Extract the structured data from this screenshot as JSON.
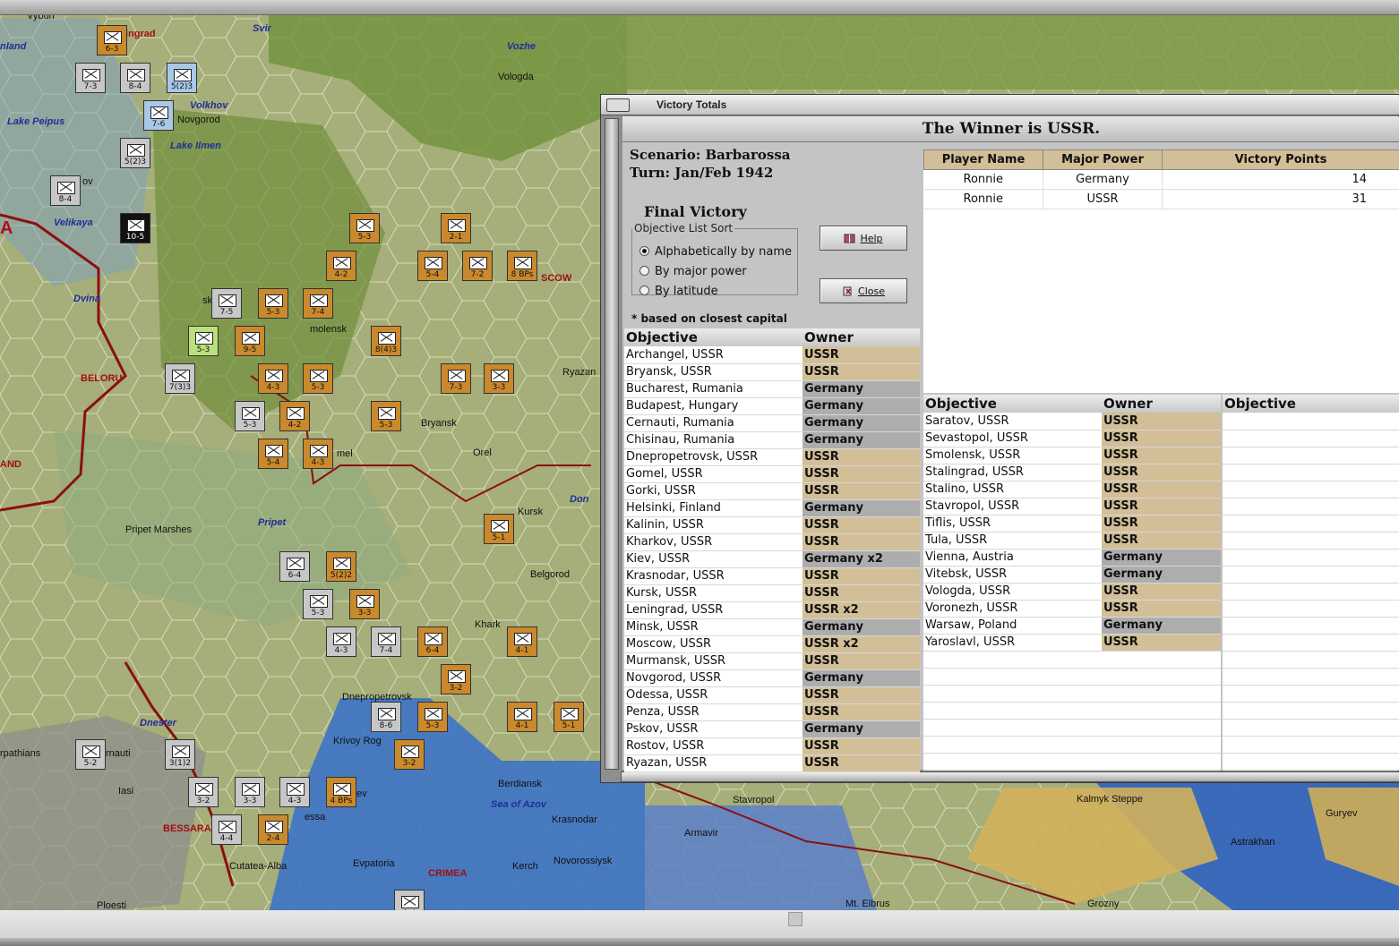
{
  "window": {
    "title": "Victory Totals",
    "winner_text": "The Winner is  USSR.",
    "scenario": "Scenario: Barbarossa",
    "turn": "Turn: Jan/Feb 1942",
    "final_victory": "Final Victory",
    "sort_legend": "Objective List Sort",
    "sort_options": [
      "Alphabetically by name",
      "By major power",
      "By latitude"
    ],
    "sort_selected": "Alphabetically by name",
    "help_label": "Help",
    "close_label": "Close",
    "note": "* based on closest capital"
  },
  "points_table": {
    "headers": [
      "Player Name",
      "Major Power",
      "Victory Points"
    ],
    "rows": [
      {
        "player": "Ronnie",
        "power": "Germany",
        "points": "14"
      },
      {
        "player": "Ronnie",
        "power": "USSR",
        "points": "31"
      }
    ]
  },
  "objective_headers": {
    "objective": "Objective",
    "owner": "Owner"
  },
  "objectives_col1": [
    {
      "name": "Archangel, USSR",
      "owner": "USSR"
    },
    {
      "name": "Bryansk, USSR",
      "owner": "USSR"
    },
    {
      "name": "Bucharest, Rumania",
      "owner": "Germany"
    },
    {
      "name": "Budapest, Hungary",
      "owner": "Germany"
    },
    {
      "name": "Cernauti, Rumania",
      "owner": "Germany"
    },
    {
      "name": "Chisinau, Rumania",
      "owner": "Germany"
    },
    {
      "name": "Dnepropetrovsk, USSR",
      "owner": "USSR"
    },
    {
      "name": "Gomel, USSR",
      "owner": "USSR"
    },
    {
      "name": "Gorki, USSR",
      "owner": "USSR"
    },
    {
      "name": "Helsinki, Finland",
      "owner": "Germany"
    },
    {
      "name": "Kalinin, USSR",
      "owner": "USSR"
    },
    {
      "name": "Kharkov, USSR",
      "owner": "USSR"
    },
    {
      "name": "Kiev, USSR",
      "owner": "Germany x2"
    },
    {
      "name": "Krasnodar, USSR",
      "owner": "USSR"
    },
    {
      "name": "Kursk, USSR",
      "owner": "USSR"
    },
    {
      "name": "Leningrad, USSR",
      "owner": "USSR x2"
    },
    {
      "name": "Minsk, USSR",
      "owner": "Germany"
    },
    {
      "name": "Moscow, USSR",
      "owner": "USSR x2"
    },
    {
      "name": "Murmansk, USSR",
      "owner": "USSR"
    },
    {
      "name": "Novgorod, USSR",
      "owner": "Germany"
    },
    {
      "name": "Odessa, USSR",
      "owner": "USSR"
    },
    {
      "name": "Penza, USSR",
      "owner": "USSR"
    },
    {
      "name": "Pskov, USSR",
      "owner": "Germany"
    },
    {
      "name": "Rostov, USSR",
      "owner": "USSR"
    },
    {
      "name": "Ryazan, USSR",
      "owner": "USSR"
    }
  ],
  "objectives_col2": [
    {
      "name": "Saratov, USSR",
      "owner": "USSR"
    },
    {
      "name": "Sevastopol, USSR",
      "owner": "USSR"
    },
    {
      "name": "Smolensk, USSR",
      "owner": "USSR"
    },
    {
      "name": "Stalingrad, USSR",
      "owner": "USSR"
    },
    {
      "name": "Stalino, USSR",
      "owner": "USSR"
    },
    {
      "name": "Stavropol, USSR",
      "owner": "USSR"
    },
    {
      "name": "Tiflis, USSR",
      "owner": "USSR"
    },
    {
      "name": "Tula, USSR",
      "owner": "USSR"
    },
    {
      "name": "Vienna, Austria",
      "owner": "Germany"
    },
    {
      "name": "Vitebsk, USSR",
      "owner": "Germany"
    },
    {
      "name": "Vologda, USSR",
      "owner": "USSR"
    },
    {
      "name": "Voronezh, USSR",
      "owner": "USSR"
    },
    {
      "name": "Warsaw, Poland",
      "owner": "Germany"
    },
    {
      "name": "Yaroslavl, USSR",
      "owner": "USSR"
    }
  ],
  "objectives_col3_header": "Objective",
  "map_labels": [
    {
      "text": "Vologda",
      "cls": "black"
    },
    {
      "text": "Vozhe",
      "cls": "blue"
    },
    {
      "text": "Svir",
      "cls": "blue"
    },
    {
      "text": "ingrad",
      "cls": "red"
    },
    {
      "text": "Volkhov",
      "cls": "blue"
    },
    {
      "text": "Novgorod",
      "cls": "black"
    },
    {
      "text": "Lake Peipus",
      "cls": "blue"
    },
    {
      "text": "Lake Ilmen",
      "cls": "blue"
    },
    {
      "text": "Velikaya",
      "cls": "blue"
    },
    {
      "text": "Dvina",
      "cls": "blue"
    },
    {
      "text": "BELORU",
      "cls": "red"
    },
    {
      "text": "molensk",
      "cls": "black"
    },
    {
      "text": "SCOW",
      "cls": "red"
    },
    {
      "text": "Bryansk",
      "cls": "black"
    },
    {
      "text": "Ryazan",
      "cls": "black"
    },
    {
      "text": "Orel",
      "cls": "black"
    },
    {
      "text": "Don",
      "cls": "blue"
    },
    {
      "text": "Kursk",
      "cls": "black"
    },
    {
      "text": "Belgorod",
      "cls": "black"
    },
    {
      "text": "Pripet",
      "cls": "blue"
    },
    {
      "text": "Pripet Marshes",
      "cls": "black"
    },
    {
      "text": "mel",
      "cls": "black"
    },
    {
      "text": "Dnester",
      "cls": "blue"
    },
    {
      "text": "Dnepropetrovsk",
      "cls": "black"
    },
    {
      "text": "Krivoy Rog",
      "cls": "black"
    },
    {
      "text": "Khark",
      "cls": "black"
    },
    {
      "text": "Berdiansk",
      "cls": "black"
    },
    {
      "text": "Sea of Azov",
      "cls": "blue"
    },
    {
      "text": "Krasnodar",
      "cls": "black"
    },
    {
      "text": "Novorossiysk",
      "cls": "black"
    },
    {
      "text": "Kerch",
      "cls": "black"
    },
    {
      "text": "CRIMEA",
      "cls": "red"
    },
    {
      "text": "Evpatoria",
      "cls": "black"
    },
    {
      "text": "Cutatea-Alba",
      "cls": "black"
    },
    {
      "text": "BESSARA",
      "cls": "red"
    },
    {
      "text": "rpathians",
      "cls": "black"
    },
    {
      "text": "rnauti",
      "cls": "black"
    },
    {
      "text": "Iasi",
      "cls": "black"
    },
    {
      "text": "Ploesti",
      "cls": "black"
    },
    {
      "text": "Stavropol",
      "cls": "black"
    },
    {
      "text": "Armavir",
      "cls": "black"
    },
    {
      "text": "Kalmyk Steppe",
      "cls": "black"
    },
    {
      "text": "Astrakhan",
      "cls": "black"
    },
    {
      "text": "Guryev",
      "cls": "black"
    },
    {
      "text": "Grozny",
      "cls": "black"
    },
    {
      "text": "Mt. Elbrus",
      "cls": "black"
    },
    {
      "text": "ev",
      "cls": "black"
    },
    {
      "text": "essa",
      "cls": "black"
    },
    {
      "text": "A",
      "cls": "country"
    },
    {
      "text": "AND",
      "cls": "red"
    },
    {
      "text": "ov",
      "cls": "black"
    },
    {
      "text": "sk",
      "cls": "black"
    },
    {
      "text": "nland",
      "cls": "blue"
    },
    {
      "text": "Vyburi",
      "cls": "black"
    }
  ],
  "units": [
    {
      "str": "6-3",
      "side": "sov"
    },
    {
      "str": "7-3",
      "side": "ger"
    },
    {
      "str": "8-4",
      "side": "ger"
    },
    {
      "str": "5(2)3",
      "side": "fin"
    },
    {
      "str": "7-6",
      "side": "fin"
    },
    {
      "str": "5(2)3",
      "side": "ger"
    },
    {
      "str": "8-4",
      "side": "ger"
    },
    {
      "str": "10-5",
      "side": "blk"
    },
    {
      "str": "5-3",
      "side": "sov"
    },
    {
      "str": "2-1",
      "side": "sov"
    },
    {
      "str": "4-2",
      "side": "sov"
    },
    {
      "str": "5-4",
      "side": "sov"
    },
    {
      "str": "7-2",
      "side": "sov"
    },
    {
      "str": "8 BPs",
      "side": "sov"
    },
    {
      "str": "7-5",
      "side": "ger"
    },
    {
      "str": "5-3",
      "side": "sov"
    },
    {
      "str": "7-4",
      "side": "sov"
    },
    {
      "str": "5-3",
      "side": "lime"
    },
    {
      "str": "9-5",
      "side": "sov"
    },
    {
      "str": "8(4)3",
      "side": "sov"
    },
    {
      "str": "7(3)3",
      "side": "ger"
    },
    {
      "str": "4-3",
      "side": "sov"
    },
    {
      "str": "5-3",
      "side": "sov"
    },
    {
      "str": "7-3",
      "side": "sov"
    },
    {
      "str": "3-3",
      "side": "sov"
    },
    {
      "str": "5-3",
      "side": "ger"
    },
    {
      "str": "4-2",
      "side": "sov"
    },
    {
      "str": "5-3",
      "side": "sov"
    },
    {
      "str": "5-4",
      "side": "sov"
    },
    {
      "str": "4-3",
      "side": "sov"
    },
    {
      "str": "5-1",
      "side": "sov"
    },
    {
      "str": "6-4",
      "side": "ger"
    },
    {
      "str": "5(2)2",
      "side": "sov"
    },
    {
      "str": "5-3",
      "side": "ger"
    },
    {
      "str": "3-3",
      "side": "sov"
    },
    {
      "str": "4-3",
      "side": "ger"
    },
    {
      "str": "7-4",
      "side": "ger"
    },
    {
      "str": "6-4",
      "side": "sov"
    },
    {
      "str": "4-1",
      "side": "sov"
    },
    {
      "str": "3-2",
      "side": "sov"
    },
    {
      "str": "8-6",
      "side": "ger"
    },
    {
      "str": "5-3",
      "side": "sov"
    },
    {
      "str": "5-2",
      "side": "ger"
    },
    {
      "str": "3(1)2",
      "side": "ger"
    },
    {
      "str": "3-2",
      "side": "ger"
    },
    {
      "str": "3-3",
      "side": "ger"
    },
    {
      "str": "4-3",
      "side": "ger"
    },
    {
      "str": "4 BPs",
      "side": "sov"
    },
    {
      "str": "4-4",
      "side": "ger"
    },
    {
      "str": "2-4",
      "side": "sov"
    },
    {
      "str": "3-2",
      "side": "sov"
    },
    {
      "str": "4-1",
      "side": "sov"
    },
    {
      "str": "5-1",
      "side": "sov"
    },
    {
      "str": "8-4",
      "side": "ger"
    }
  ]
}
